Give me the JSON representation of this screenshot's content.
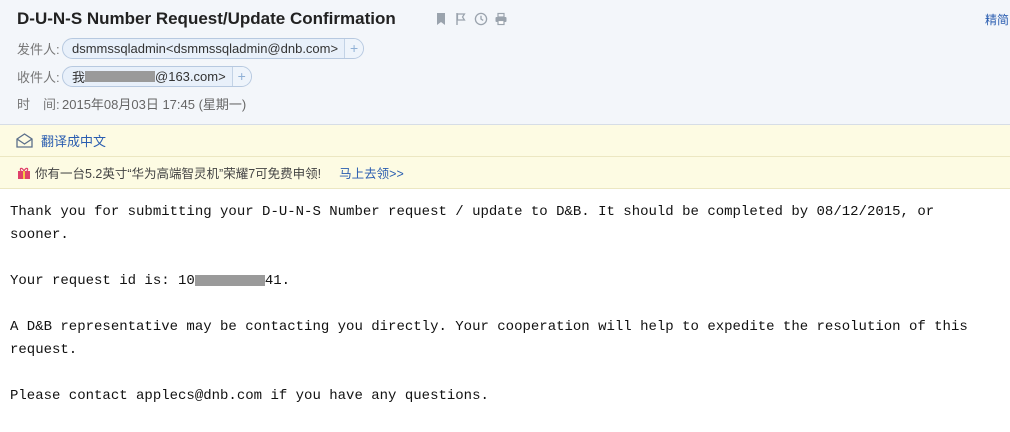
{
  "email": {
    "subject": "D-U-N-S Number Request/Update Confirmation",
    "top_right_link": "精简",
    "from": {
      "label": "发件人:",
      "name": "dsmmssqladmin",
      "address": "<dsmmssqladmin@dnb.com>",
      "add_symbol": "+"
    },
    "to": {
      "label": "收件人:",
      "prefix": "我",
      "suffix": "@163.com>",
      "add_symbol": "+"
    },
    "time": {
      "label": "时　间:",
      "value": "2015年08月03日 17:45 (星期一)"
    }
  },
  "translate_bar": {
    "label": "翻译成中文"
  },
  "promo_bar": {
    "text": "你有一台5.2英寸“华为高端智灵机”荣耀7可免费申领!",
    "link": "马上去领>>"
  },
  "message": {
    "line1": "Thank you for submitting your D-U-N-S Number request / update to D&B. It should be completed by 08/12/2015, or sooner.",
    "request_id_prefix": "Your request id is: 10",
    "request_id_suffix": "41.",
    "line3": "A D&B representative may be contacting you directly.  Your cooperation will help to expedite the resolution of this request.",
    "line4": "Please contact applecs@dnb.com if you have any questions."
  }
}
